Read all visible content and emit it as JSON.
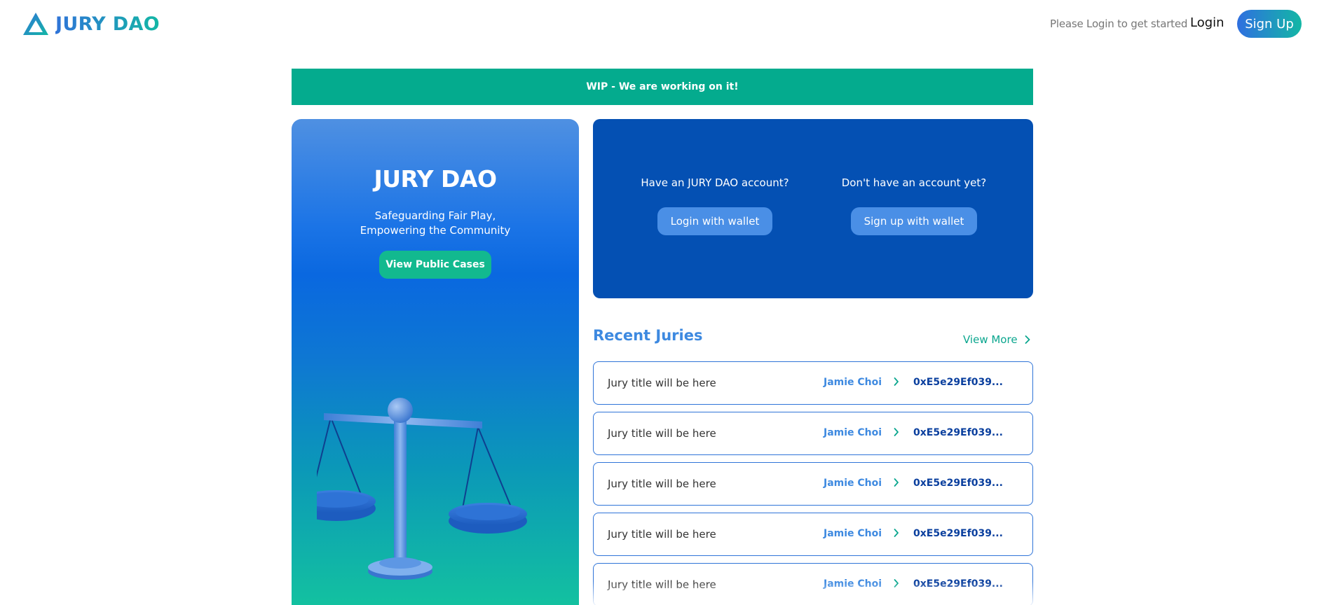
{
  "header": {
    "brand": "JURY DAO",
    "hint": "Please Login to get started",
    "login_label": "Login",
    "signup_label": "Sign Up"
  },
  "banner": {
    "text": "WIP - We are working on it!"
  },
  "hero": {
    "title": "JURY DAO",
    "subtitle_line1": "Safeguarding Fair Play,",
    "subtitle_line2": "Empowering the Community",
    "button_label": "View Public Cases",
    "illustration": "balance-scales-icon"
  },
  "account": {
    "existing": {
      "question": "Have an JURY DAO account?",
      "button_label": "Login with wallet"
    },
    "new": {
      "question": "Don't have an account yet?",
      "button_label": "Sign up with wallet"
    }
  },
  "recent": {
    "title": "Recent Juries",
    "view_more_label": "View More",
    "items": [
      {
        "title": "Jury title will be here",
        "name": "Jamie Choi",
        "address": "0xE5e29Ef039..."
      },
      {
        "title": "Jury title will be here",
        "name": "Jamie Choi",
        "address": "0xE5e29Ef039..."
      },
      {
        "title": "Jury title will be here",
        "name": "Jamie Choi",
        "address": "0xE5e29Ef039..."
      },
      {
        "title": "Jury title will be here",
        "name": "Jamie Choi",
        "address": "0xE5e29Ef039..."
      },
      {
        "title": "Jury title will be here",
        "name": "Jamie Choi",
        "address": "0xE5e29Ef039..."
      }
    ]
  },
  "colors": {
    "brand_blue": "#2f73d8",
    "brand_teal": "#13b7a5",
    "banner_green": "#04ab8e",
    "account_navy": "#0450b3"
  }
}
